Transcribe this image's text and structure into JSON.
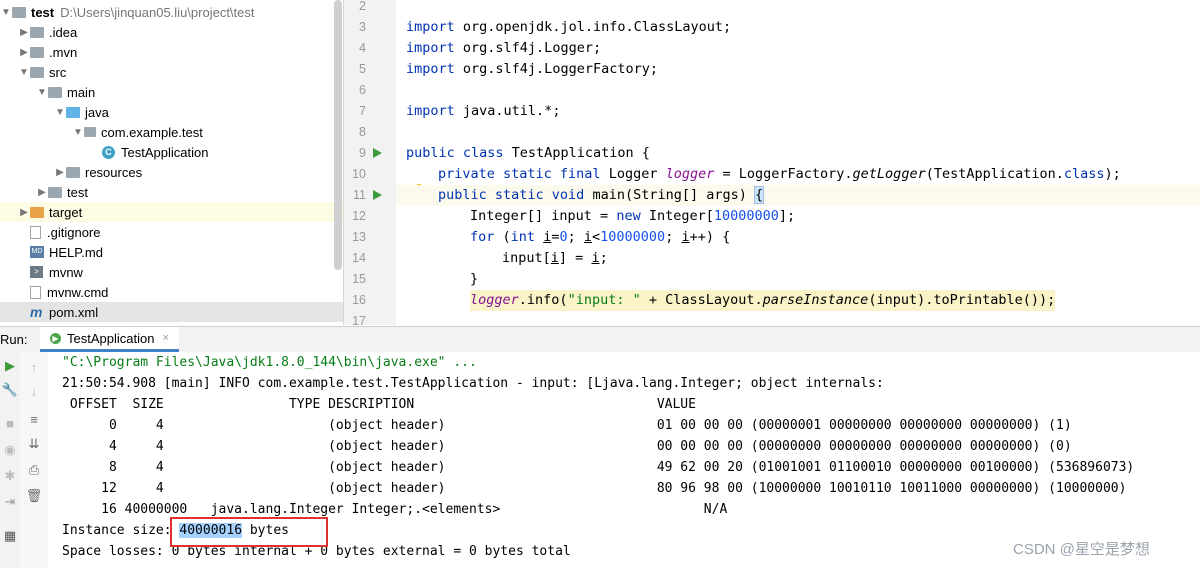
{
  "project_tree": {
    "root": {
      "name": "test",
      "path": "D:\\Users\\jinquan05.liu\\project\\test"
    },
    "items": [
      {
        "label": ".idea",
        "depth": 1,
        "type": "folder-grey",
        "expander": "collapsed"
      },
      {
        "label": ".mvn",
        "depth": 1,
        "type": "folder-grey",
        "expander": "collapsed"
      },
      {
        "label": "src",
        "depth": 1,
        "type": "folder-grey",
        "expander": "expanded"
      },
      {
        "label": "main",
        "depth": 2,
        "type": "folder-grey",
        "expander": "expanded"
      },
      {
        "label": "java",
        "depth": 3,
        "type": "folder-blue",
        "expander": "expanded"
      },
      {
        "label": "com.example.test",
        "depth": 4,
        "type": "package",
        "expander": "expanded"
      },
      {
        "label": "TestApplication",
        "depth": 5,
        "type": "class",
        "expander": "none"
      },
      {
        "label": "resources",
        "depth": 3,
        "type": "folder-grey",
        "expander": "collapsed"
      },
      {
        "label": "test",
        "depth": 2,
        "type": "folder-grey",
        "expander": "collapsed"
      },
      {
        "label": "target",
        "depth": 1,
        "type": "folder-orange",
        "expander": "collapsed"
      },
      {
        "label": ".gitignore",
        "depth": 1,
        "type": "file",
        "expander": "none"
      },
      {
        "label": "HELP.md",
        "depth": 1,
        "type": "md",
        "expander": "none"
      },
      {
        "label": "mvnw",
        "depth": 1,
        "type": "terminal",
        "expander": "none"
      },
      {
        "label": "mvnw.cmd",
        "depth": 1,
        "type": "file",
        "expander": "none"
      },
      {
        "label": "pom.xml",
        "depth": 1,
        "type": "maven",
        "expander": "none"
      }
    ]
  },
  "editor": {
    "line_numbers": [
      "2",
      "3",
      "4",
      "5",
      "6",
      "7",
      "8",
      "9",
      "10",
      "11",
      "12",
      "13",
      "14",
      "15",
      "16",
      "17"
    ],
    "code": {
      "l3": [
        "import",
        " org.openjdk.jol.info.ClassLayout;"
      ],
      "l4": [
        "import",
        " org.slf4j.Logger;"
      ],
      "l5": [
        "import",
        " org.slf4j.LoggerFactory;"
      ],
      "l7": [
        "import",
        " java.util.*;"
      ],
      "l9": [
        "public class",
        " TestApplication {"
      ],
      "l10": [
        "private static final",
        " Logger ",
        "logger",
        " = LoggerFactory.",
        "getLogger",
        "(TestApplication.",
        "class",
        ");"
      ],
      "l11": [
        "public static void",
        " main(String[] args) ",
        "{"
      ],
      "l12": [
        "Integer[] input = ",
        "new",
        " Integer[",
        "10000000",
        "];"
      ],
      "l13": [
        "for",
        " (",
        "int",
        " ",
        "i",
        "=",
        "0",
        "; ",
        "i",
        "<",
        "10000000",
        "; ",
        "i",
        "++) {"
      ],
      "l14": [
        "input[",
        "i",
        "] = ",
        "i",
        ";"
      ],
      "l15": [
        "}"
      ],
      "l16": [
        "logger",
        ".info(",
        "\"input: \"",
        " + ClassLayout.",
        "parseInstance",
        "(input).toPrintable());"
      ]
    }
  },
  "run_panel": {
    "label": "Run:",
    "tab": "TestApplication",
    "tab_close": "×",
    "console": {
      "cmd": "\"C:\\Program Files\\Java\\jdk1.8.0_144\\bin\\java.exe\" ...",
      "log": "21:50:54.908 [main] INFO com.example.test.TestApplication - input: [Ljava.lang.Integer; object internals:",
      "header": " OFFSET  SIZE                TYPE DESCRIPTION                               VALUE",
      "rows": [
        "      0     4                     (object header)                           01 00 00 00 (00000001 00000000 00000000 00000000) (1)",
        "      4     4                     (object header)                           00 00 00 00 (00000000 00000000 00000000 00000000) (0)",
        "      8     4                     (object header)                           49 62 00 20 (01001001 01100010 00000000 00100000) (536896073)",
        "     12     4                     (object header)                           80 96 98 00 (10000000 10010110 10011000 00000000) (10000000)",
        "     16 40000000   java.lang.Integer Integer;.<elements>                          N/A"
      ],
      "instance_prefix": "Instance size: ",
      "instance_value": "40000016",
      "instance_suffix": " bytes",
      "space_losses": "Space losses: 0 bytes internal + 0 bytes external = 0 bytes total"
    }
  },
  "watermark": "CSDN @星空是梦想",
  "colors": {
    "keyword": "#0033b3",
    "number": "#1750eb",
    "string": "#067d17",
    "field": "#871094",
    "highlight_box": "#e03030"
  }
}
